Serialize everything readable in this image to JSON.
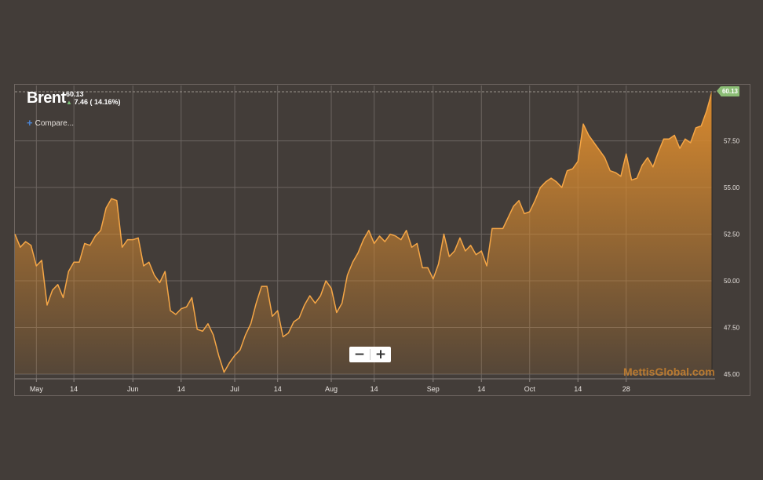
{
  "header": {
    "title": "Brent",
    "last_price": "60.13",
    "change": "7.46 ( 14.16%)"
  },
  "compare_label": "Compare...",
  "zoom": {
    "out_label": "−",
    "in_label": "+"
  },
  "watermark": "MettisGlobal.com",
  "price_badge": "60.13",
  "colors": {
    "background": "#433d39",
    "line": "#f5a646",
    "area_top": "#d98a2e",
    "up": "#7cc27a"
  },
  "chart_data": {
    "type": "area",
    "title": "Brent",
    "ylim": [
      45.0,
      60.13
    ],
    "y_ticks": [
      "45.00",
      "47.50",
      "50.00",
      "52.50",
      "55.00",
      "57.50"
    ],
    "x_ticks": [
      {
        "label": "May",
        "index": 4
      },
      {
        "label": "14",
        "index": 11
      },
      {
        "label": "Jun",
        "index": 22
      },
      {
        "label": "14",
        "index": 31
      },
      {
        "label": "Jul",
        "index": 41
      },
      {
        "label": "14",
        "index": 49
      },
      {
        "label": "Aug",
        "index": 59
      },
      {
        "label": "14",
        "index": 67
      },
      {
        "label": "Sep",
        "index": 78
      },
      {
        "label": "14",
        "index": 87
      },
      {
        "label": "Oct",
        "index": 96
      },
      {
        "label": "14",
        "index": 105
      },
      {
        "label": "28",
        "index": 114
      }
    ],
    "grid": true,
    "series": [
      {
        "values": [
          52.5,
          51.8,
          52.1,
          51.9,
          50.8,
          51.1,
          48.7,
          49.5,
          49.8,
          49.1,
          50.5,
          51.0,
          51.0,
          52.0,
          51.9,
          52.4,
          52.7,
          53.9,
          54.4,
          54.3,
          51.8,
          52.2,
          52.2,
          52.3,
          50.8,
          51.0,
          50.3,
          49.9,
          50.5,
          48.4,
          48.2,
          48.5,
          48.6,
          49.1,
          47.4,
          47.3,
          47.7,
          47.1,
          46.0,
          45.1,
          45.6,
          46.0,
          46.3,
          47.1,
          47.7,
          48.8,
          49.7,
          49.7,
          48.1,
          48.4,
          47.0,
          47.2,
          47.8,
          48.0,
          48.7,
          49.2,
          48.8,
          49.2,
          50.0,
          49.6,
          48.3,
          48.8,
          50.3,
          51.0,
          51.5,
          52.2,
          52.7,
          52.0,
          52.4,
          52.1,
          52.5,
          52.4,
          52.2,
          52.7,
          51.8,
          52.0,
          50.7,
          50.7,
          50.1,
          50.9,
          52.5,
          51.3,
          51.6,
          52.3,
          51.6,
          51.9,
          51.4,
          51.6,
          50.8,
          52.8,
          52.8,
          52.8,
          53.4,
          54.0,
          54.3,
          53.6,
          53.7,
          54.3,
          55.0,
          55.3,
          55.5,
          55.3,
          55.0,
          55.9,
          56.0,
          56.4,
          58.4,
          57.8,
          57.4,
          57.0,
          56.6,
          55.9,
          55.8,
          55.6,
          56.8,
          55.4,
          55.5,
          56.2,
          56.6,
          56.1,
          56.9,
          57.6,
          57.6,
          57.8,
          57.1,
          57.6,
          57.4,
          58.2,
          58.3,
          59.1,
          60.13
        ]
      }
    ]
  }
}
